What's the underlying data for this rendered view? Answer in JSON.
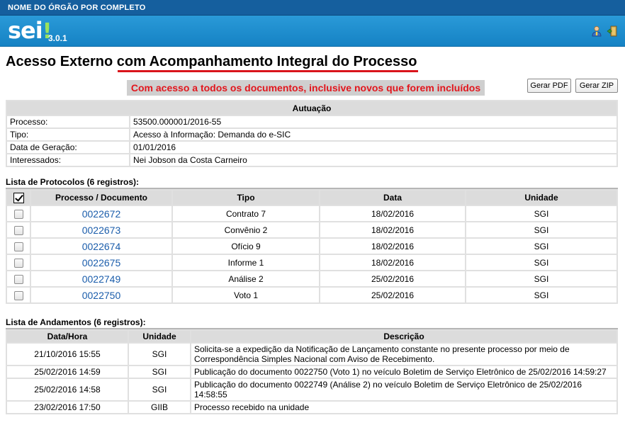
{
  "org_name": "NOME DO ÓRGÃO POR COMPLETO",
  "app": {
    "logo": "sei",
    "logo_bang": "!",
    "version": "3.0.1"
  },
  "header_icons": [
    "user-icon",
    "exit-icon"
  ],
  "page_title": "Acesso Externo com Acompanhamento Integral do Processo",
  "banner": "Com acesso a todos os documentos, inclusive novos que forem incluídos",
  "buttons": {
    "pdf": "Gerar PDF",
    "zip": "Gerar ZIP"
  },
  "autuacao": {
    "heading": "Autuação",
    "rows": [
      {
        "label": "Processo:",
        "value": "53500.000001/2016-55"
      },
      {
        "label": "Tipo:",
        "value": "Acesso à Informação: Demanda do e-SIC"
      },
      {
        "label": "Data de Geração:",
        "value": "01/01/2016"
      },
      {
        "label": "Interessados:",
        "value": "Nei Jobson da Costa Carneiro"
      }
    ]
  },
  "protocolos": {
    "caption": "Lista de Protocolos (6 registros):",
    "columns": [
      "Processo / Documento",
      "Tipo",
      "Data",
      "Unidade"
    ],
    "rows": [
      {
        "doc": "0022672",
        "tipo": "Contrato 7",
        "data": "18/02/2016",
        "unidade": "SGI"
      },
      {
        "doc": "0022673",
        "tipo": "Convênio 2",
        "data": "18/02/2016",
        "unidade": "SGI"
      },
      {
        "doc": "0022674",
        "tipo": "Ofício 9",
        "data": "18/02/2016",
        "unidade": "SGI"
      },
      {
        "doc": "0022675",
        "tipo": "Informe 1",
        "data": "18/02/2016",
        "unidade": "SGI"
      },
      {
        "doc": "0022749",
        "tipo": "Análise 2",
        "data": "25/02/2016",
        "unidade": "SGI"
      },
      {
        "doc": "0022750",
        "tipo": "Voto 1",
        "data": "25/02/2016",
        "unidade": "SGI"
      }
    ]
  },
  "andamentos": {
    "caption": "Lista de Andamentos (6 registros):",
    "columns": [
      "Data/Hora",
      "Unidade",
      "Descrição"
    ],
    "rows": [
      {
        "dh": "21/10/2016 15:55",
        "unidade": "SGI",
        "desc": "Solicita-se a expedição da Notificação de Lançamento constante no presente processo por meio de Correspondência Simples Nacional com Aviso de Recebimento."
      },
      {
        "dh": "25/02/2016 14:59",
        "unidade": "SGI",
        "desc": "Publicação do documento 0022750 (Voto 1) no veículo Boletim de Serviço Eletrônico de 25/02/2016 14:59:27"
      },
      {
        "dh": "25/02/2016 14:58",
        "unidade": "SGI",
        "desc": "Publicação do documento 0022749 (Análise 2) no veículo Boletim de Serviço Eletrônico de 25/02/2016 14:58:55"
      },
      {
        "dh": "23/02/2016 17:50",
        "unidade": "GIIB",
        "desc": "Processo recebido na unidade"
      }
    ]
  }
}
